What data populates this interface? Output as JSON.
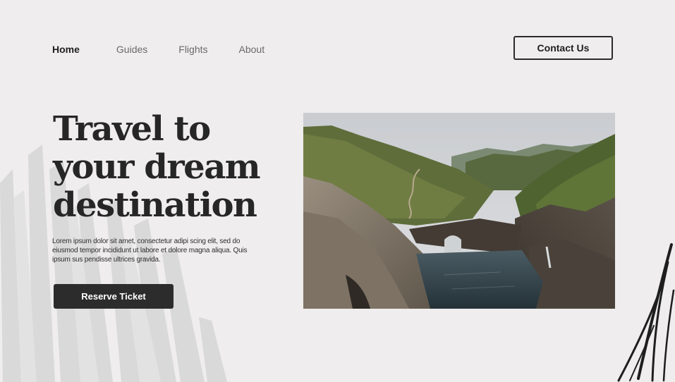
{
  "nav": {
    "items": [
      {
        "label": "Home",
        "active": true
      },
      {
        "label": "Guides",
        "active": false
      },
      {
        "label": "Flights",
        "active": false
      },
      {
        "label": "About",
        "active": false
      }
    ],
    "contact_label": "Contact Us"
  },
  "hero": {
    "title_lines": [
      "Travel to",
      "your dream",
      "destination"
    ],
    "description": "Lorem ipsum dolor sit amet, consectetur adipi scing elit, sed do eiusmod tempor incididunt ut labore et dolore magna aliqua. Quis ipsum sus pendisse ultrices gravida.",
    "cta_label": "Reserve Ticket"
  },
  "colors": {
    "background": "#efeded",
    "primary_dark": "#2c2c2c",
    "nav_muted": "#6a6a6a"
  }
}
